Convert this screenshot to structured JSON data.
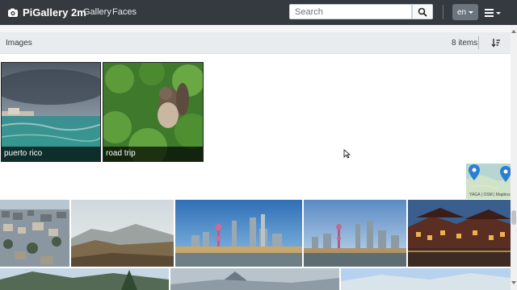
{
  "navbar": {
    "brand": "PiGallery 2m",
    "links": {
      "gallery": "Gallery",
      "faces": "Faces"
    },
    "search_placeholder": "Search",
    "language": "en"
  },
  "toolbar": {
    "title": "Images",
    "count": "8 items"
  },
  "directories": [
    {
      "name": "puerto rico"
    },
    {
      "name": "road trip"
    }
  ],
  "map": {
    "attribution": "YAGA | OSM | Mapbox"
  },
  "icons": {
    "brand": "camera-icon",
    "search": "search-icon",
    "menu": "hamburger-menu-icon",
    "sort": "sort-icon",
    "map_pin": "map-pin-icon"
  },
  "colors": {
    "navbar_bg": "#343a40",
    "toolbar_bg": "#e9ecef",
    "lang_button": "#6c757d",
    "map_pin": "#2a7fd4"
  }
}
